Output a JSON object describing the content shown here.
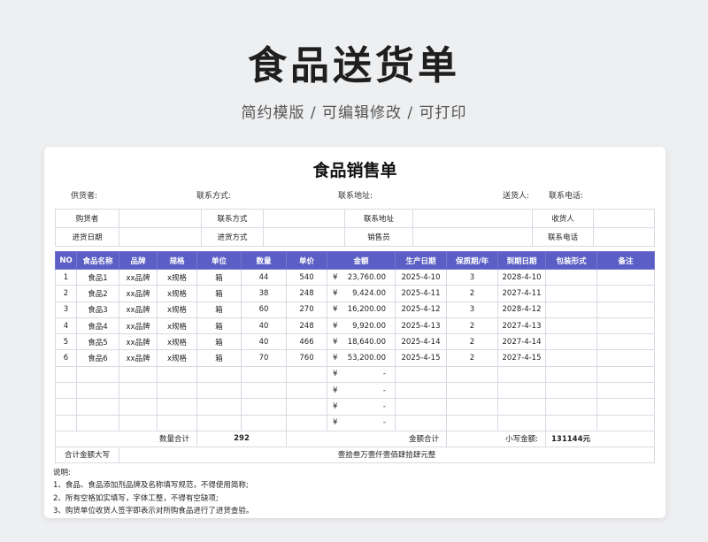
{
  "hero": {
    "title": "食品送货单",
    "subtitle": "简约模版 / 可编辑修改 / 可打印"
  },
  "sheet": {
    "title": "食品销售单",
    "meta": {
      "supplier_label": "供货者:",
      "contact_label": "联系方式:",
      "address_label": "联系地址:",
      "shipper_label": "送货人:",
      "phone_label": "联系电话:"
    },
    "info_rows": [
      [
        "购货者",
        "",
        "联系方式",
        "",
        "联系地址",
        "",
        "收货人",
        ""
      ],
      [
        "进货日期",
        "",
        "进货方式",
        "",
        "销售员",
        "",
        "联系电话",
        ""
      ]
    ],
    "table": {
      "headers": [
        "NO",
        "食品名称",
        "品牌",
        "规格",
        "单位",
        "数量",
        "单价",
        "金额",
        "生产日期",
        "保质期/年",
        "到期日期",
        "包装形式",
        "备注"
      ],
      "currency": "¥",
      "rows": [
        {
          "no": "1",
          "name": "食品1",
          "brand": "xx品牌",
          "spec": "x规格",
          "unit": "箱",
          "qty": "44",
          "price": "540",
          "amount": "23,760.00",
          "prod": "2025-4-10",
          "shelf": "3",
          "expire": "2028-4-10",
          "pack": "",
          "note": ""
        },
        {
          "no": "2",
          "name": "食品2",
          "brand": "xx品牌",
          "spec": "x规格",
          "unit": "箱",
          "qty": "38",
          "price": "248",
          "amount": "9,424.00",
          "prod": "2025-4-11",
          "shelf": "2",
          "expire": "2027-4-11",
          "pack": "",
          "note": ""
        },
        {
          "no": "3",
          "name": "食品3",
          "brand": "xx品牌",
          "spec": "x规格",
          "unit": "箱",
          "qty": "60",
          "price": "270",
          "amount": "16,200.00",
          "prod": "2025-4-12",
          "shelf": "3",
          "expire": "2028-4-12",
          "pack": "",
          "note": ""
        },
        {
          "no": "4",
          "name": "食品4",
          "brand": "xx品牌",
          "spec": "x规格",
          "unit": "箱",
          "qty": "40",
          "price": "248",
          "amount": "9,920.00",
          "prod": "2025-4-13",
          "shelf": "2",
          "expire": "2027-4-13",
          "pack": "",
          "note": ""
        },
        {
          "no": "5",
          "name": "食品5",
          "brand": "xx品牌",
          "spec": "x规格",
          "unit": "箱",
          "qty": "40",
          "price": "466",
          "amount": "18,640.00",
          "prod": "2025-4-14",
          "shelf": "2",
          "expire": "2027-4-14",
          "pack": "",
          "note": ""
        },
        {
          "no": "6",
          "name": "食品6",
          "brand": "xx品牌",
          "spec": "x规格",
          "unit": "箱",
          "qty": "70",
          "price": "760",
          "amount": "53,200.00",
          "prod": "2025-4-15",
          "shelf": "2",
          "expire": "2027-4-15",
          "pack": "",
          "note": ""
        },
        {
          "no": "",
          "name": "",
          "brand": "",
          "spec": "",
          "unit": "",
          "qty": "",
          "price": "",
          "amount": "-",
          "prod": "",
          "shelf": "",
          "expire": "",
          "pack": "",
          "note": ""
        },
        {
          "no": "",
          "name": "",
          "brand": "",
          "spec": "",
          "unit": "",
          "qty": "",
          "price": "",
          "amount": "-",
          "prod": "",
          "shelf": "",
          "expire": "",
          "pack": "",
          "note": ""
        },
        {
          "no": "",
          "name": "",
          "brand": "",
          "spec": "",
          "unit": "",
          "qty": "",
          "price": "",
          "amount": "-",
          "prod": "",
          "shelf": "",
          "expire": "",
          "pack": "",
          "note": ""
        },
        {
          "no": "",
          "name": "",
          "brand": "",
          "spec": "",
          "unit": "",
          "qty": "",
          "price": "",
          "amount": "-",
          "prod": "",
          "shelf": "",
          "expire": "",
          "pack": "",
          "note": ""
        }
      ]
    },
    "totals": {
      "qty_label": "数量合计",
      "qty_value": "292",
      "amount_label": "金额合计",
      "small_label": "小写金额:",
      "small_value": "131144元",
      "big_label": "合计金额大写",
      "big_value": "壹拾叁万壹仟壹佰肆拾肆元整"
    },
    "notes": [
      "说明:",
      "1、食品、食品添加剂品牌及名称填写规范，不得使用简称;",
      "2、所有空格如实填写，字体工整，不得有空缺项;",
      "3、购货单位收货人签字即表示对所购食品进行了进货查验。"
    ]
  }
}
